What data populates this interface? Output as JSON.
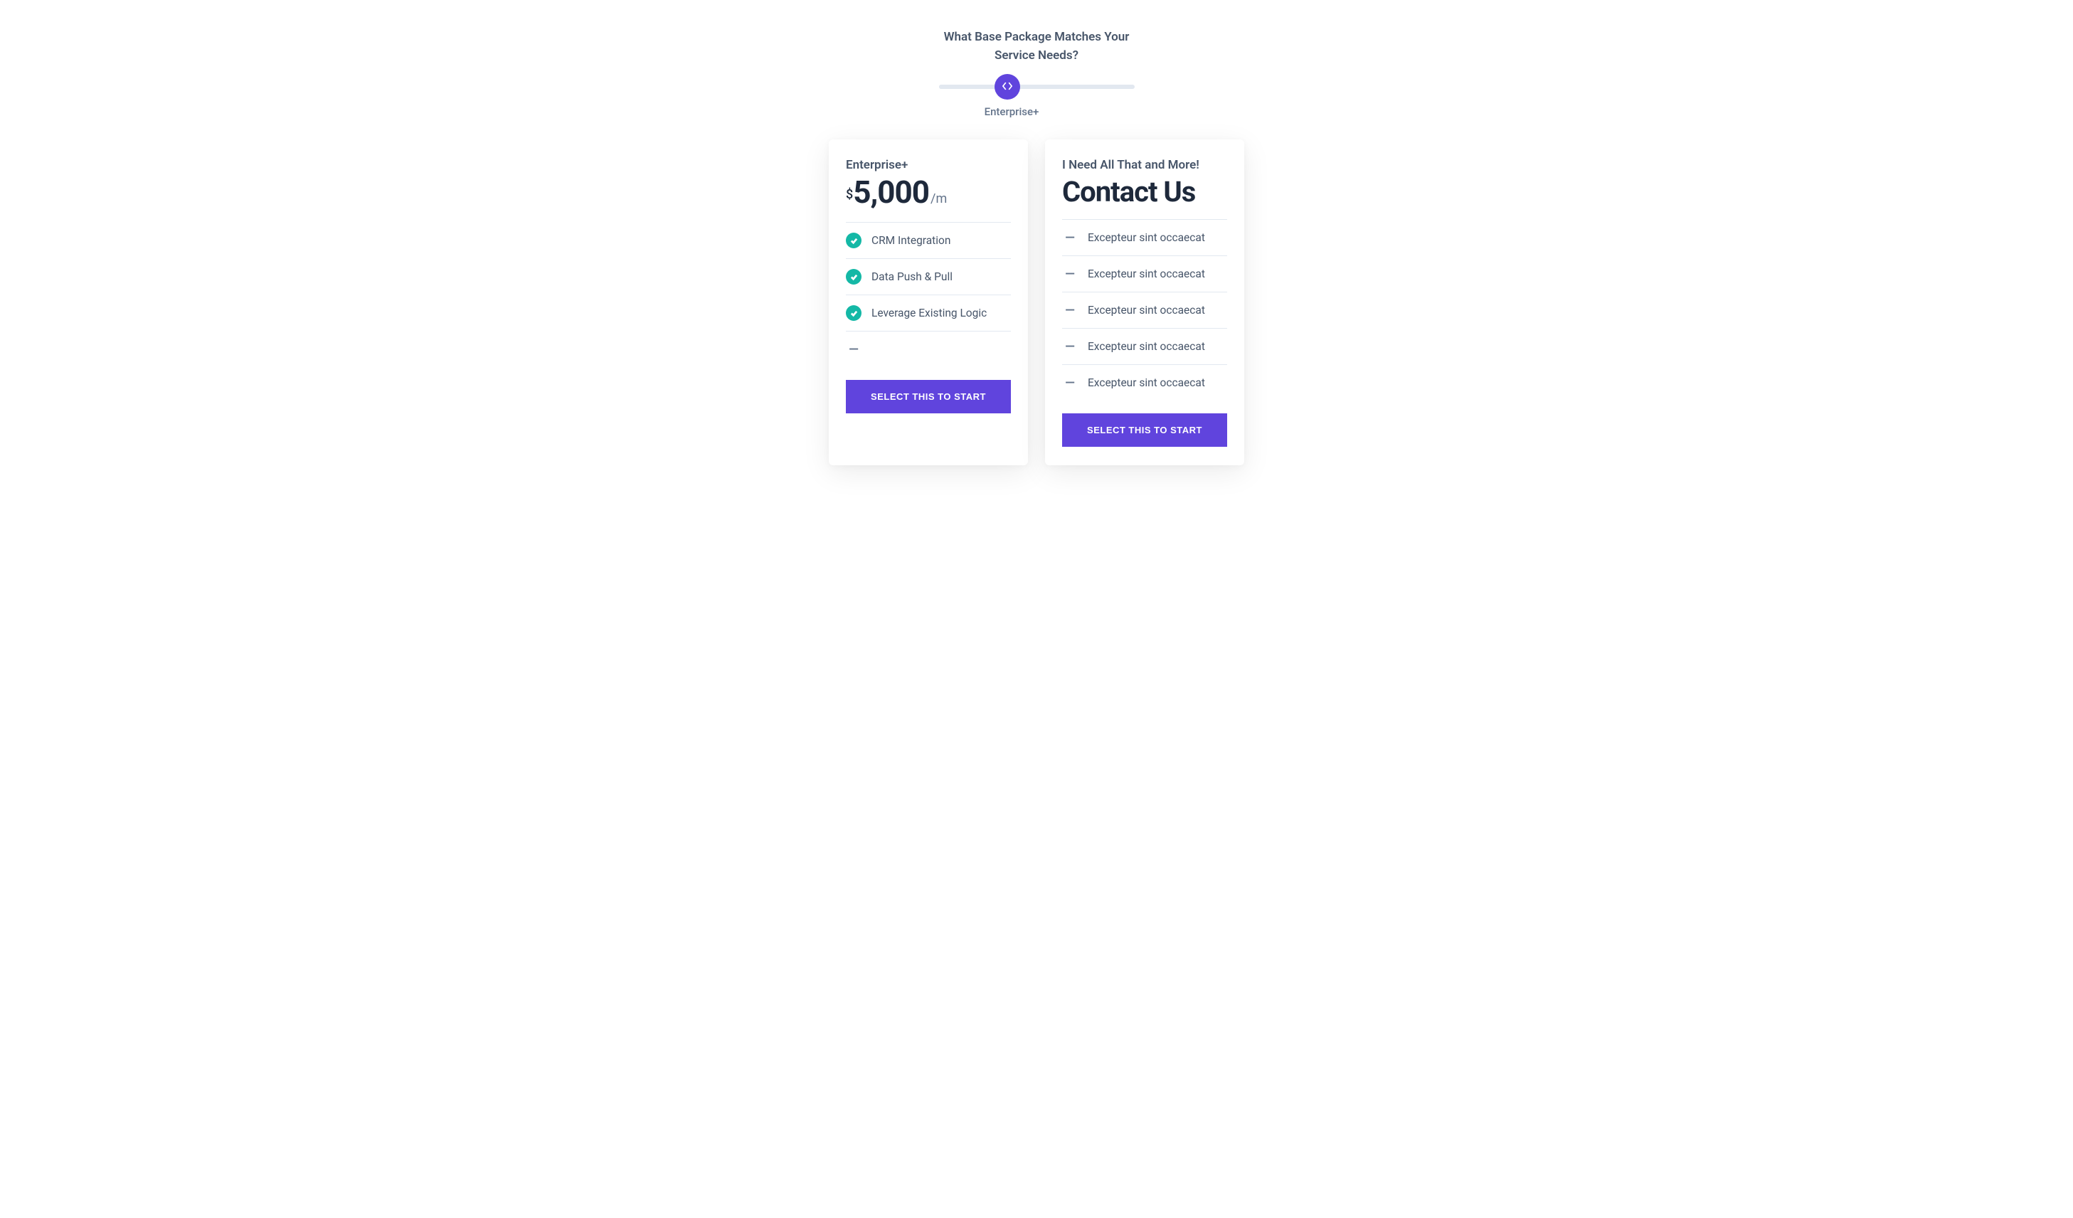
{
  "heading": "What Base Package Matches Your Service Needs?",
  "slider": {
    "label": "Enterprise+",
    "position_percent": 35
  },
  "cards": [
    {
      "title": "Enterprise+",
      "currency": "$",
      "price": "5,000",
      "period": "/m",
      "features": [
        {
          "icon": "check",
          "text": "CRM Integration"
        },
        {
          "icon": "check",
          "text": "Data Push & Pull"
        },
        {
          "icon": "check",
          "text": "Leverage Existing Logic"
        },
        {
          "icon": "dash",
          "text": ""
        }
      ],
      "button": "SELECT THIS TO START"
    },
    {
      "title": "I Need All That and More!",
      "contact_heading": "Contact Us",
      "features": [
        {
          "icon": "dash",
          "text": "Excepteur sint occaecat"
        },
        {
          "icon": "dash",
          "text": "Excepteur sint occaecat"
        },
        {
          "icon": "dash",
          "text": "Excepteur sint occaecat"
        },
        {
          "icon": "dash",
          "text": "Excepteur sint occaecat"
        },
        {
          "icon": "dash",
          "text": "Excepteur sint occaecat"
        }
      ],
      "button": "SELECT THIS TO START"
    }
  ]
}
